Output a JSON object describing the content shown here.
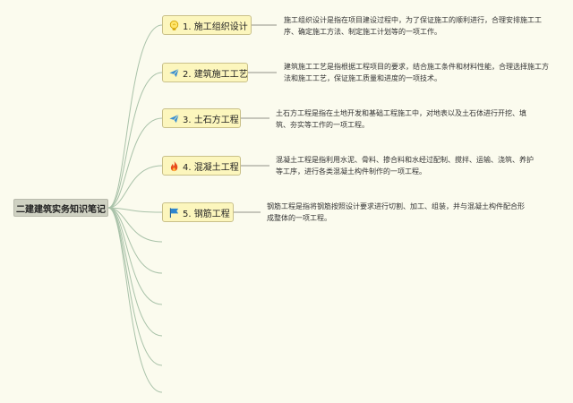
{
  "root": {
    "label": "二建建筑实务知识笔记"
  },
  "nodes": [
    {
      "label": "1. 施工组织设计",
      "icon": "bulb-icon",
      "description": "施工组织设计是指在项目建设过程中，为了保证施工的顺利进行，合理安排施工工序、确定施工方法、制定施工计划等的一项工作。"
    },
    {
      "label": "2. 建筑施工工艺",
      "icon": "paper-plane-icon",
      "description": "建筑施工工艺是指根据工程项目的要求，结合施工条件和材料性能，合理选择施工方法和施工工艺，保证施工质量和进度的一项技术。"
    },
    {
      "label": "3. 土石方工程",
      "icon": "paper-plane-icon",
      "description": "土石方工程是指在土地开发和基础工程施工中，对地表以及土石体进行开挖、填筑、夯实等工作的一项工程。"
    },
    {
      "label": "4. 混凝土工程",
      "icon": "fire-icon",
      "description": "混凝土工程是指利用水泥、骨料、掺合料和水经过配制、搅拌、运输、浇筑、养护等工序，进行各类混凝土构件制作的一项工程。"
    },
    {
      "label": "5. 钢筋工程",
      "icon": "flag-icon",
      "description": "钢筋工程是指将钢筋按照设计要求进行切割、加工、组装，并与混凝土构件配合形成整体的一项工程。"
    }
  ],
  "colors": {
    "branch": "#A9C2A9",
    "node_fill": "#FCF6BD",
    "node_border": "#C9C089",
    "root_fill": "#CFD1C2",
    "icon_blue": "#3A8FD0",
    "icon_fire": "#E84B1C"
  }
}
